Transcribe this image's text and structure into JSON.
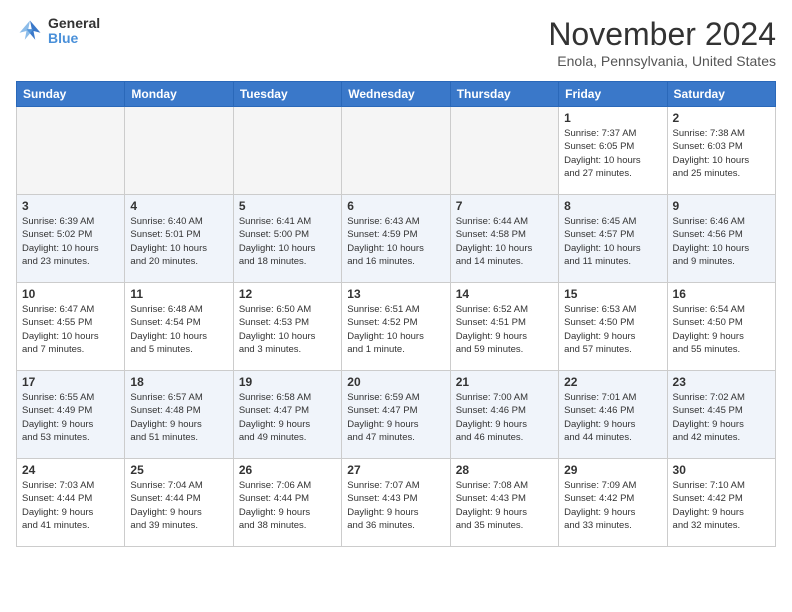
{
  "logo": {
    "line1": "General",
    "line2": "Blue"
  },
  "title": "November 2024",
  "location": "Enola, Pennsylvania, United States",
  "weekdays": [
    "Sunday",
    "Monday",
    "Tuesday",
    "Wednesday",
    "Thursday",
    "Friday",
    "Saturday"
  ],
  "weeks": [
    [
      {
        "day": "",
        "info": ""
      },
      {
        "day": "",
        "info": ""
      },
      {
        "day": "",
        "info": ""
      },
      {
        "day": "",
        "info": ""
      },
      {
        "day": "",
        "info": ""
      },
      {
        "day": "1",
        "info": "Sunrise: 7:37 AM\nSunset: 6:05 PM\nDaylight: 10 hours\nand 27 minutes."
      },
      {
        "day": "2",
        "info": "Sunrise: 7:38 AM\nSunset: 6:03 PM\nDaylight: 10 hours\nand 25 minutes."
      }
    ],
    [
      {
        "day": "3",
        "info": "Sunrise: 6:39 AM\nSunset: 5:02 PM\nDaylight: 10 hours\nand 23 minutes."
      },
      {
        "day": "4",
        "info": "Sunrise: 6:40 AM\nSunset: 5:01 PM\nDaylight: 10 hours\nand 20 minutes."
      },
      {
        "day": "5",
        "info": "Sunrise: 6:41 AM\nSunset: 5:00 PM\nDaylight: 10 hours\nand 18 minutes."
      },
      {
        "day": "6",
        "info": "Sunrise: 6:43 AM\nSunset: 4:59 PM\nDaylight: 10 hours\nand 16 minutes."
      },
      {
        "day": "7",
        "info": "Sunrise: 6:44 AM\nSunset: 4:58 PM\nDaylight: 10 hours\nand 14 minutes."
      },
      {
        "day": "8",
        "info": "Sunrise: 6:45 AM\nSunset: 4:57 PM\nDaylight: 10 hours\nand 11 minutes."
      },
      {
        "day": "9",
        "info": "Sunrise: 6:46 AM\nSunset: 4:56 PM\nDaylight: 10 hours\nand 9 minutes."
      }
    ],
    [
      {
        "day": "10",
        "info": "Sunrise: 6:47 AM\nSunset: 4:55 PM\nDaylight: 10 hours\nand 7 minutes."
      },
      {
        "day": "11",
        "info": "Sunrise: 6:48 AM\nSunset: 4:54 PM\nDaylight: 10 hours\nand 5 minutes."
      },
      {
        "day": "12",
        "info": "Sunrise: 6:50 AM\nSunset: 4:53 PM\nDaylight: 10 hours\nand 3 minutes."
      },
      {
        "day": "13",
        "info": "Sunrise: 6:51 AM\nSunset: 4:52 PM\nDaylight: 10 hours\nand 1 minute."
      },
      {
        "day": "14",
        "info": "Sunrise: 6:52 AM\nSunset: 4:51 PM\nDaylight: 9 hours\nand 59 minutes."
      },
      {
        "day": "15",
        "info": "Sunrise: 6:53 AM\nSunset: 4:50 PM\nDaylight: 9 hours\nand 57 minutes."
      },
      {
        "day": "16",
        "info": "Sunrise: 6:54 AM\nSunset: 4:50 PM\nDaylight: 9 hours\nand 55 minutes."
      }
    ],
    [
      {
        "day": "17",
        "info": "Sunrise: 6:55 AM\nSunset: 4:49 PM\nDaylight: 9 hours\nand 53 minutes."
      },
      {
        "day": "18",
        "info": "Sunrise: 6:57 AM\nSunset: 4:48 PM\nDaylight: 9 hours\nand 51 minutes."
      },
      {
        "day": "19",
        "info": "Sunrise: 6:58 AM\nSunset: 4:47 PM\nDaylight: 9 hours\nand 49 minutes."
      },
      {
        "day": "20",
        "info": "Sunrise: 6:59 AM\nSunset: 4:47 PM\nDaylight: 9 hours\nand 47 minutes."
      },
      {
        "day": "21",
        "info": "Sunrise: 7:00 AM\nSunset: 4:46 PM\nDaylight: 9 hours\nand 46 minutes."
      },
      {
        "day": "22",
        "info": "Sunrise: 7:01 AM\nSunset: 4:46 PM\nDaylight: 9 hours\nand 44 minutes."
      },
      {
        "day": "23",
        "info": "Sunrise: 7:02 AM\nSunset: 4:45 PM\nDaylight: 9 hours\nand 42 minutes."
      }
    ],
    [
      {
        "day": "24",
        "info": "Sunrise: 7:03 AM\nSunset: 4:44 PM\nDaylight: 9 hours\nand 41 minutes."
      },
      {
        "day": "25",
        "info": "Sunrise: 7:04 AM\nSunset: 4:44 PM\nDaylight: 9 hours\nand 39 minutes."
      },
      {
        "day": "26",
        "info": "Sunrise: 7:06 AM\nSunset: 4:44 PM\nDaylight: 9 hours\nand 38 minutes."
      },
      {
        "day": "27",
        "info": "Sunrise: 7:07 AM\nSunset: 4:43 PM\nDaylight: 9 hours\nand 36 minutes."
      },
      {
        "day": "28",
        "info": "Sunrise: 7:08 AM\nSunset: 4:43 PM\nDaylight: 9 hours\nand 35 minutes."
      },
      {
        "day": "29",
        "info": "Sunrise: 7:09 AM\nSunset: 4:42 PM\nDaylight: 9 hours\nand 33 minutes."
      },
      {
        "day": "30",
        "info": "Sunrise: 7:10 AM\nSunset: 4:42 PM\nDaylight: 9 hours\nand 32 minutes."
      }
    ]
  ]
}
